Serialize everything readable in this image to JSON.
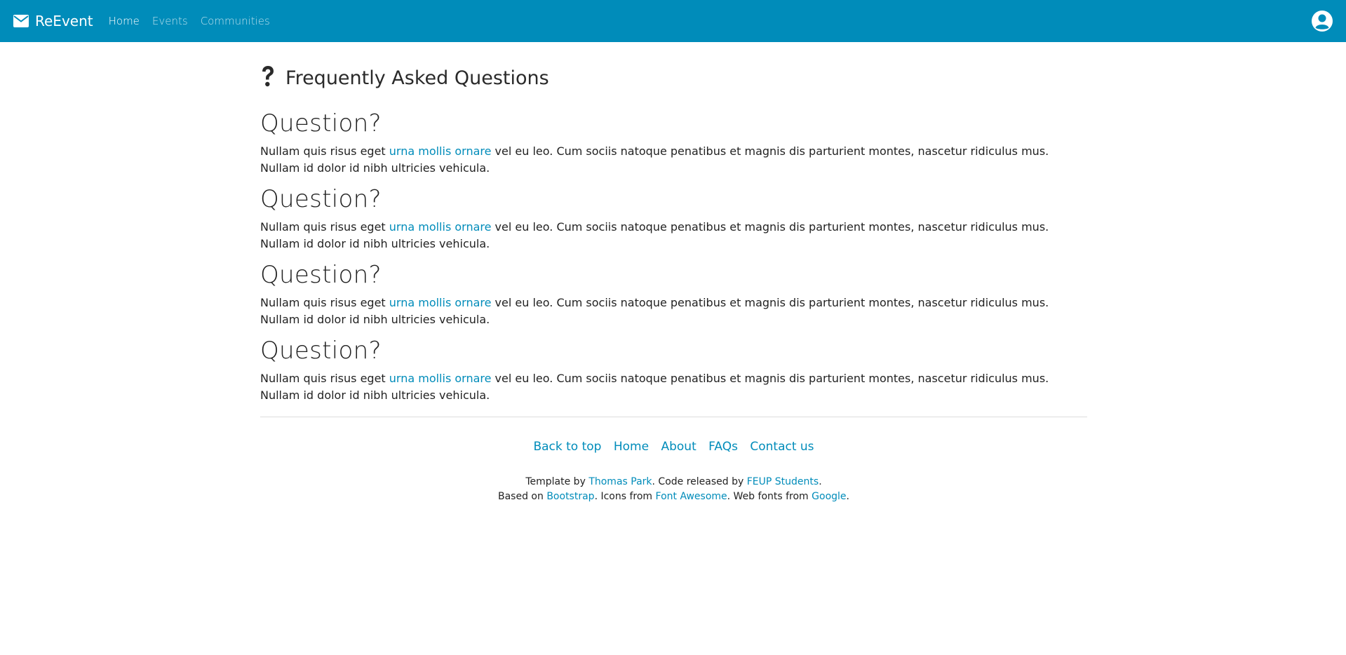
{
  "navbar": {
    "brand": "ReEvent",
    "links": [
      {
        "label": "Home",
        "active": true
      },
      {
        "label": "Events",
        "active": false
      },
      {
        "label": "Communities",
        "active": false
      }
    ],
    "brand_icon": "envelope-icon",
    "user_icon": "user-circle-icon"
  },
  "colors": {
    "primary": "#008cba",
    "text": "#222222",
    "divider": "#dddddd"
  },
  "page": {
    "title": "Frequently Asked Questions",
    "title_icon": "question-icon"
  },
  "faqs": [
    {
      "question": "Question?",
      "answer_before": "Nullam quis risus eget ",
      "answer_link": "urna mollis ornare",
      "answer_after": " vel eu leo. Cum sociis natoque penatibus et magnis dis parturient montes, nascetur ridiculus mus. Nullam id dolor id nibh ultricies vehicula."
    },
    {
      "question": "Question?",
      "answer_before": "Nullam quis risus eget ",
      "answer_link": "urna mollis ornare",
      "answer_after": " vel eu leo. Cum sociis natoque penatibus et magnis dis parturient montes, nascetur ridiculus mus. Nullam id dolor id nibh ultricies vehicula."
    },
    {
      "question": "Question?",
      "answer_before": "Nullam quis risus eget ",
      "answer_link": "urna mollis ornare",
      "answer_after": " vel eu leo. Cum sociis natoque penatibus et magnis dis parturient montes, nascetur ridiculus mus. Nullam id dolor id nibh ultricies vehicula."
    },
    {
      "question": "Question?",
      "answer_before": "Nullam quis risus eget ",
      "answer_link": "urna mollis ornare",
      "answer_after": " vel eu leo. Cum sociis natoque penatibus et magnis dis parturient montes, nascetur ridiculus mus. Nullam id dolor id nibh ultricies vehicula."
    }
  ],
  "footer": {
    "links": [
      "Back to top",
      "Home",
      "About",
      "FAQs",
      "Contact us"
    ],
    "line1": {
      "t1": "Template by ",
      "l1": "Thomas Park",
      "t2": ". Code released by ",
      "l2": "FEUP Students",
      "t3": "."
    },
    "line2": {
      "t1": "Based on ",
      "l1": "Bootstrap",
      "t2": ". Icons from ",
      "l2": "Font Awesome",
      "t3": ". Web fonts from ",
      "l3": "Google",
      "t4": "."
    }
  }
}
